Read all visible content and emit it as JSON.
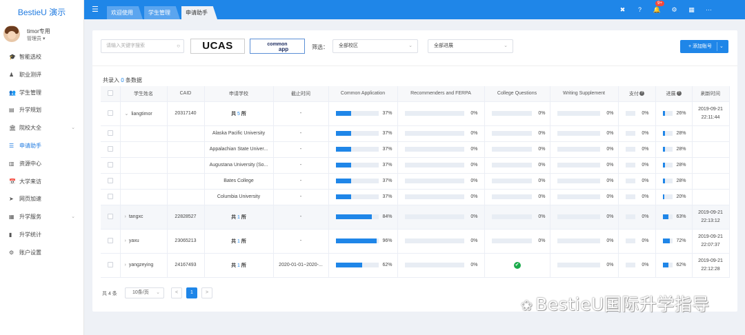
{
  "brand": "BestieU 演示",
  "user": {
    "name": "timor专用",
    "role": "管理员 ▾"
  },
  "menu": [
    {
      "icon": "🎓",
      "label": "智能选校"
    },
    {
      "icon": "♟",
      "label": "职业测评"
    },
    {
      "icon": "👥",
      "label": "学生管理"
    },
    {
      "icon": "▤",
      "label": "升学规划"
    },
    {
      "icon": "🏛",
      "label": "院校大全",
      "arrow": "⌄"
    },
    {
      "icon": "☰",
      "label": "申请助手",
      "active": true
    },
    {
      "icon": "▥",
      "label": "资源中心"
    },
    {
      "icon": "📅",
      "label": "大学来访"
    },
    {
      "icon": "➤",
      "label": "网页加速"
    },
    {
      "icon": "▦",
      "label": "升学服务",
      "arrow": "⌄"
    },
    {
      "icon": "▮",
      "label": "升学统计"
    },
    {
      "icon": "⚙",
      "label": "账户设置"
    }
  ],
  "tabs": [
    "欢迎使用",
    "学生管理",
    "申请助手"
  ],
  "notifications_badge": "9+",
  "search": {
    "placeholder": "请输入关键字搜索"
  },
  "logos": {
    "ucas": "UCAS",
    "commonapp_1": "common",
    "commonapp_2": "app"
  },
  "filter": {
    "label": "筛选：",
    "school": "全部校区",
    "progress": "全部进展"
  },
  "add_button": "+ 添加账号",
  "total": {
    "prefix": "共录入",
    "count": "0",
    "suffix": "条数据"
  },
  "columns": [
    "",
    "学生姓名",
    "CAID",
    "申请学校",
    "截止时间",
    "Common Application",
    "Recommenders and FERPA",
    "College Questions",
    "Writing Supplement",
    "支付",
    "进展",
    "刷新时间"
  ],
  "rows": [
    {
      "type": "main",
      "name": "liangtimor",
      "expanded": true,
      "caid": "20317140",
      "school_count": {
        "pre": "共",
        "n": "5",
        "post": "所"
      },
      "deadline": "-",
      "common_app": 37,
      "recommenders": 0,
      "college_q": 0,
      "writing": 0,
      "payment": 0,
      "progress": 26,
      "refresh": [
        "2019-09-21",
        "22:11:44"
      ]
    },
    {
      "type": "sub",
      "school": "Alaska Pacific University",
      "deadline": "-",
      "common_app": 37,
      "recommenders": 0,
      "college_q": 0,
      "writing": 0,
      "payment": 0,
      "progress": 28
    },
    {
      "type": "sub",
      "school": "Appalachian State Univer...",
      "deadline": "-",
      "common_app": 37,
      "recommenders": 0,
      "college_q": 0,
      "writing": 0,
      "payment": 0,
      "progress": 28
    },
    {
      "type": "sub",
      "school": "Augustana University (So...",
      "deadline": "-",
      "common_app": 37,
      "recommenders": 0,
      "college_q": 0,
      "writing": 0,
      "payment": 0,
      "progress": 28
    },
    {
      "type": "sub",
      "school": "Bates College",
      "deadline": "-",
      "common_app": 37,
      "recommenders": 0,
      "college_q": 0,
      "writing": 0,
      "payment": 0,
      "progress": 28
    },
    {
      "type": "sub",
      "school": "Columbia University",
      "deadline": "-",
      "common_app": 37,
      "recommenders": 0,
      "college_q": 0,
      "writing": 0,
      "payment": 0,
      "progress": 20
    },
    {
      "type": "main",
      "name": "tangxc",
      "shade": true,
      "caid": "22828527",
      "school_count": {
        "pre": "共",
        "n": "1",
        "post": "所"
      },
      "deadline": "-",
      "common_app": 84,
      "recommenders": 0,
      "college_q": 0,
      "writing": 0,
      "payment": 0,
      "progress": 63,
      "refresh": [
        "2019-09-21",
        "22:13:12"
      ]
    },
    {
      "type": "main",
      "name": "yaxu",
      "caid": "23065213",
      "school_count": {
        "pre": "共",
        "n": "1",
        "post": "所"
      },
      "deadline": "-",
      "common_app": 96,
      "recommenders": 0,
      "college_q": 0,
      "writing": 0,
      "payment": 0,
      "progress": 72,
      "refresh": [
        "2019-09-21",
        "22:07:37"
      ]
    },
    {
      "type": "main",
      "name": "yangzeying",
      "caid": "24167493",
      "school_count": {
        "pre": "共",
        "n": "1",
        "post": "所"
      },
      "deadline": "2020-01-01~2020-...",
      "common_app": 62,
      "recommenders": 0,
      "college_q": "check",
      "writing": 0,
      "payment": 0,
      "progress": 62,
      "refresh": [
        "2019-09-21",
        "22:12:28"
      ]
    }
  ],
  "pager": {
    "total": "共 4 条",
    "size": "10条/页",
    "prev": "<",
    "page": "1",
    "next": ">"
  },
  "watermark": "BestieU国际升学指导"
}
